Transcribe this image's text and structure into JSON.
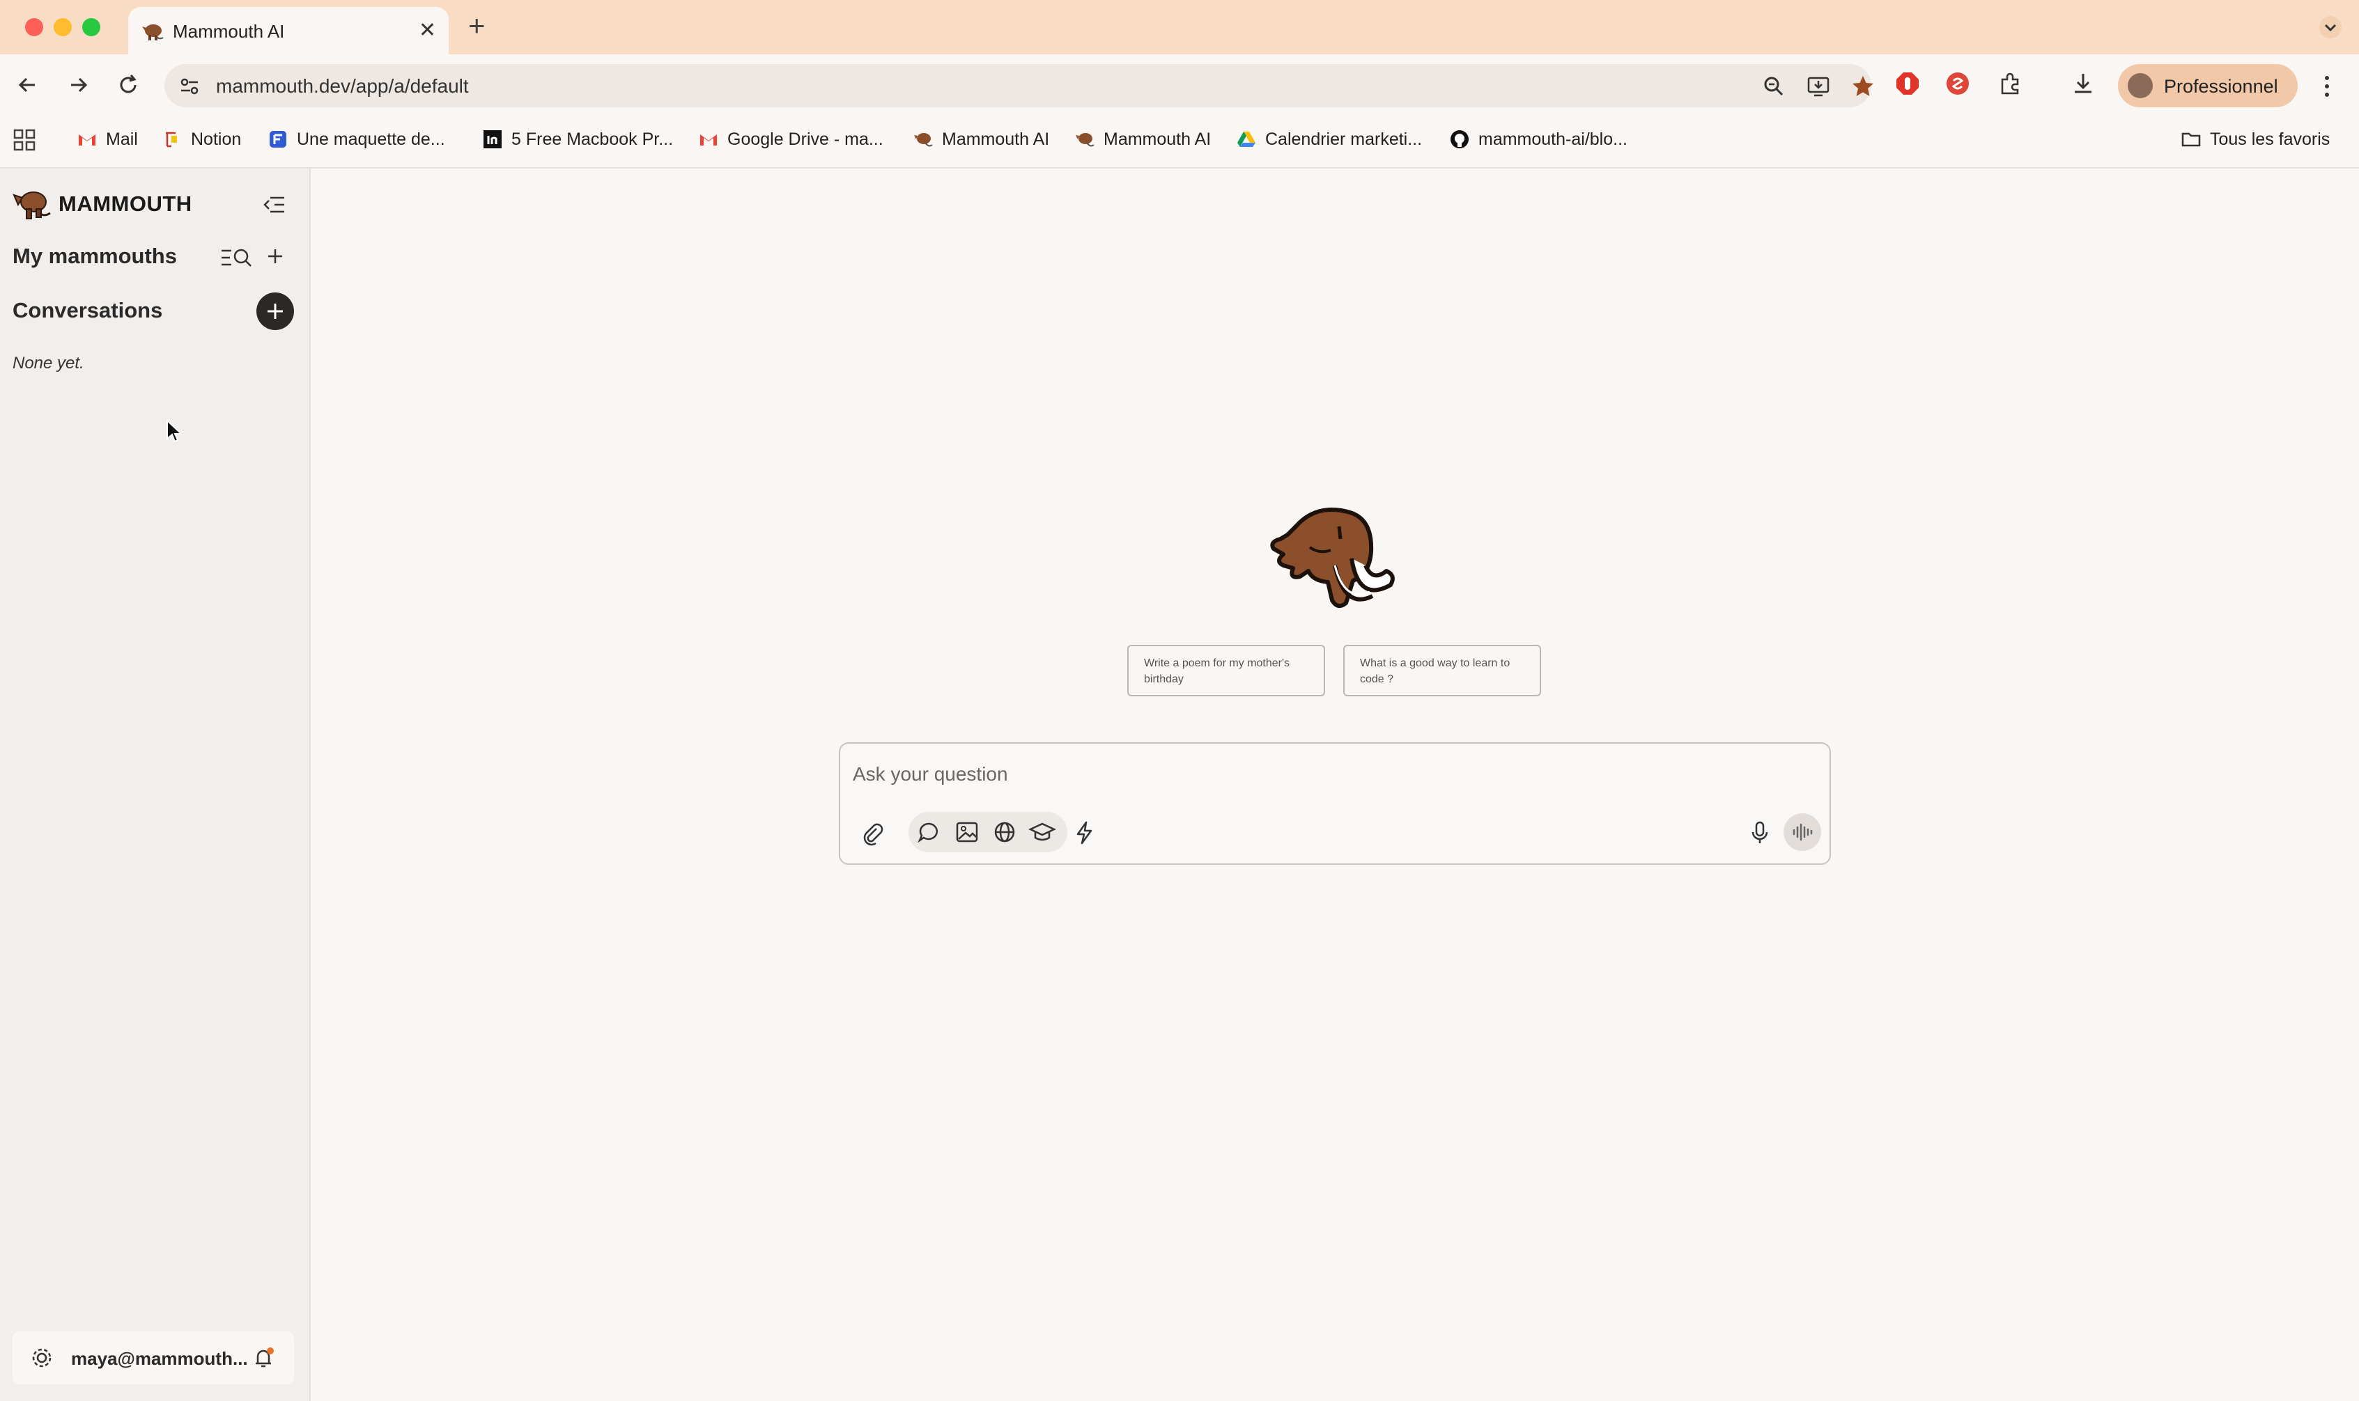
{
  "browser": {
    "tab": {
      "title": "Mammouth AI",
      "icon": "mammoth-favicon-icon"
    },
    "url": "mammouth.dev/app/a/default",
    "profile_label": "Professionnel",
    "bookmarks": [
      {
        "label": "Mail",
        "icon": "gmail-icon"
      },
      {
        "label": "Notion",
        "icon": "notion-icon"
      },
      {
        "label": "Une maquette de...",
        "icon": "doc-icon"
      },
      {
        "label": "5 Free Macbook Pr...",
        "icon": "invision-icon"
      },
      {
        "label": "Google Drive - ma...",
        "icon": "gmail-icon"
      },
      {
        "label": "Mammouth AI",
        "icon": "mammoth-favicon-icon"
      },
      {
        "label": "Mammouth AI",
        "icon": "mammoth-favicon-icon"
      },
      {
        "label": "Calendrier marketi...",
        "icon": "drive-icon"
      },
      {
        "label": "mammouth-ai/blo...",
        "icon": "github-icon"
      }
    ],
    "all_bookmarks_label": "Tous les favoris"
  },
  "sidebar": {
    "brand": "MAMMOUTH",
    "my_mammouths_title": "My mammouths",
    "conversations_title": "Conversations",
    "empty_text": "None yet.",
    "user_email": "maya@mammouth..."
  },
  "main": {
    "suggestions": [
      "Write a poem for my mother's birthday",
      "What is a good way to learn to code ?"
    ],
    "composer": {
      "placeholder": "Ask your question",
      "value": ""
    }
  },
  "colors": {
    "titlebar": "#f8dcc4",
    "profile_pill": "#f2c9a8",
    "sidebar_bg": "#f2eeeb",
    "page_bg": "#f9f6f3",
    "mammoth_brown": "#8b4f2c"
  }
}
